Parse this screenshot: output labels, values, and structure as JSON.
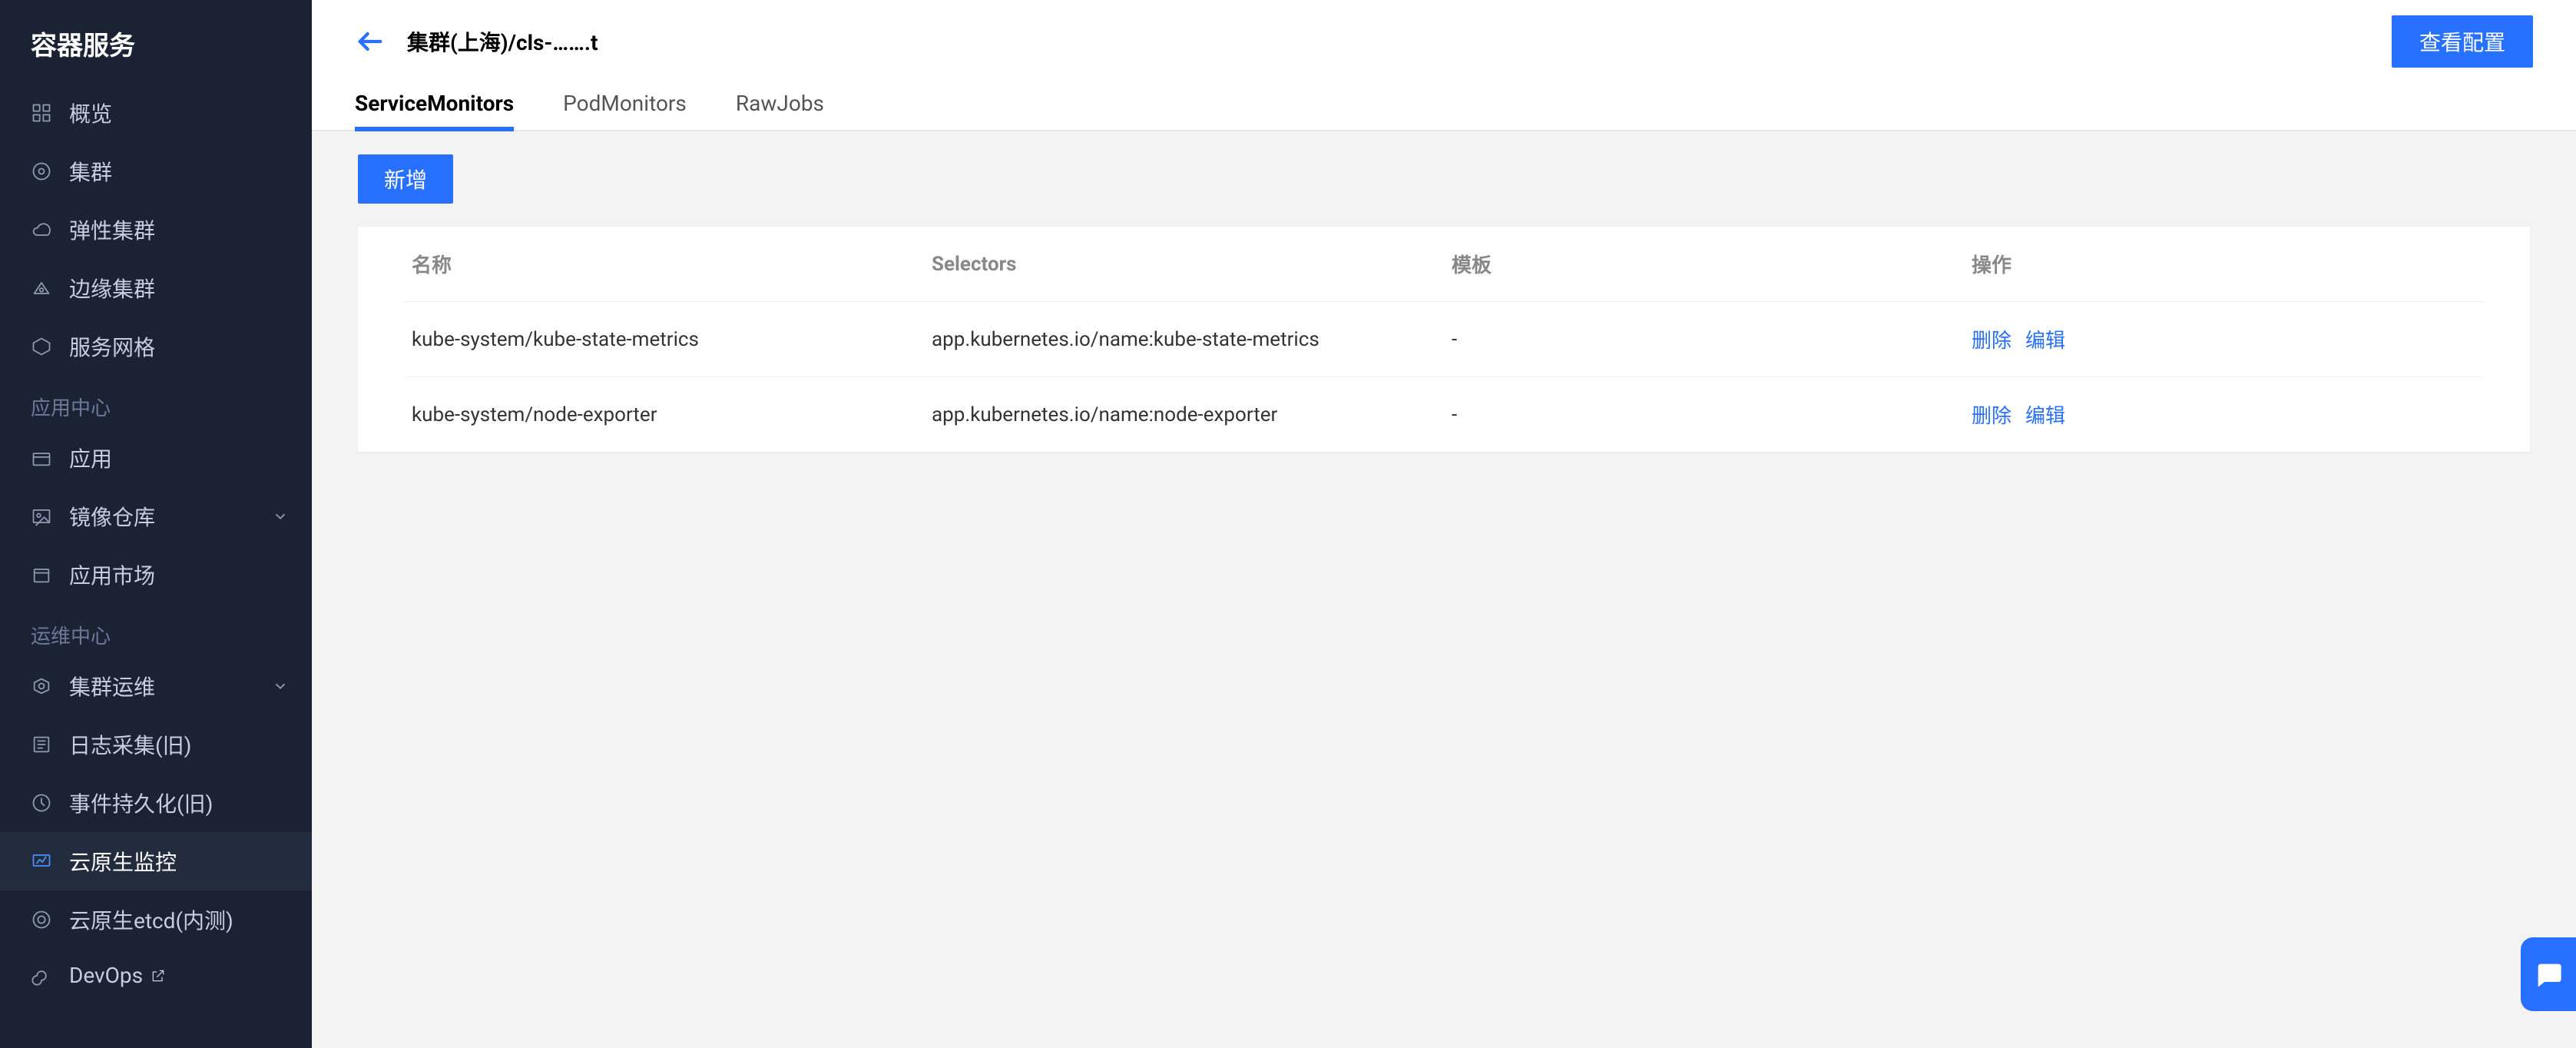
{
  "sidebar": {
    "title": "容器服务",
    "groups": [
      {
        "label": null,
        "items": [
          {
            "icon": "grid",
            "label": "概览"
          },
          {
            "icon": "target",
            "label": "集群"
          },
          {
            "icon": "cloud",
            "label": "弹性集群"
          },
          {
            "icon": "edge",
            "label": "边缘集群"
          },
          {
            "icon": "mesh",
            "label": "服务网格"
          }
        ]
      },
      {
        "label": "应用中心",
        "items": [
          {
            "icon": "app",
            "label": "应用"
          },
          {
            "icon": "image",
            "label": "镜像仓库",
            "expandable": true
          },
          {
            "icon": "market",
            "label": "应用市场"
          }
        ]
      },
      {
        "label": "运维中心",
        "items": [
          {
            "icon": "ops",
            "label": "集群运维",
            "expandable": true
          },
          {
            "icon": "log",
            "label": "日志采集(旧)"
          },
          {
            "icon": "event",
            "label": "事件持久化(旧)"
          },
          {
            "icon": "monitor",
            "label": "云原生监控",
            "active": true
          },
          {
            "icon": "etcd",
            "label": "云原生etcd(内测)"
          },
          {
            "icon": "devops",
            "label": "DevOps",
            "external": true
          }
        ]
      }
    ]
  },
  "header": {
    "breadcrumb": "集群(上海)/cls-…….t",
    "view_config_label": "查看配置"
  },
  "tabs": [
    {
      "label": "ServiceMonitors",
      "active": true
    },
    {
      "label": "PodMonitors",
      "active": false
    },
    {
      "label": "RawJobs",
      "active": false
    }
  ],
  "add_button_label": "新增",
  "table": {
    "columns": [
      "名称",
      "Selectors",
      "模板",
      "操作"
    ],
    "rows": [
      {
        "name": "kube-system/kube-state-metrics",
        "selectors": "app.kubernetes.io/name:kube-state-metrics",
        "template": "-"
      },
      {
        "name": "kube-system/node-exporter",
        "selectors": "app.kubernetes.io/name:node-exporter",
        "template": "-"
      }
    ],
    "actions": {
      "delete": "删除",
      "edit": "编辑"
    }
  }
}
